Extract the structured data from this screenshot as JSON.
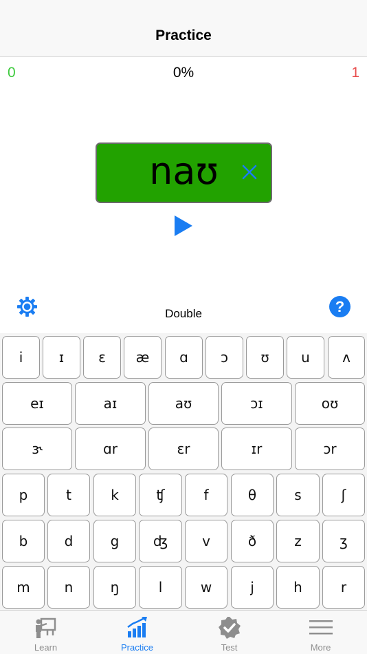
{
  "navbar": {
    "title": "Practice"
  },
  "score": {
    "correct": "0",
    "percent": "0%",
    "wrong": "1"
  },
  "answer": {
    "word": "naʊ"
  },
  "controls": {
    "mode": "Double",
    "help": "?"
  },
  "keyboard": {
    "row1": [
      "i",
      "ɪ",
      "ɛ",
      "æ",
      "ɑ",
      "ɔ",
      "ʊ",
      "u",
      "ʌ"
    ],
    "row2": [
      "eɪ",
      "aɪ",
      "aʊ",
      "ɔɪ",
      "oʊ"
    ],
    "row3": [
      "ɝ",
      "ɑr",
      "ɛr",
      "ɪr",
      "ɔr"
    ],
    "row4": [
      "p",
      "t",
      "k",
      "ʧ",
      "f",
      "θ",
      "s",
      "ʃ"
    ],
    "row5": [
      "b",
      "d",
      "g",
      "ʤ",
      "v",
      "ð",
      "z",
      "ʒ"
    ],
    "row6": [
      "m",
      "n",
      "ŋ",
      "l",
      "w",
      "j",
      "h",
      "r"
    ]
  },
  "tabbar": {
    "tabs": [
      {
        "label": "Learn",
        "icon": "teacher-board-icon"
      },
      {
        "label": "Practice",
        "icon": "bar-chart-icon",
        "active": true
      },
      {
        "label": "Test",
        "icon": "check-badge-icon"
      },
      {
        "label": "More",
        "icon": "menu-icon"
      }
    ]
  },
  "colors": {
    "accent": "#1a7df2",
    "correct": "#3dca3d",
    "wrong": "#e84d4d",
    "answer_bg": "#22a200"
  }
}
